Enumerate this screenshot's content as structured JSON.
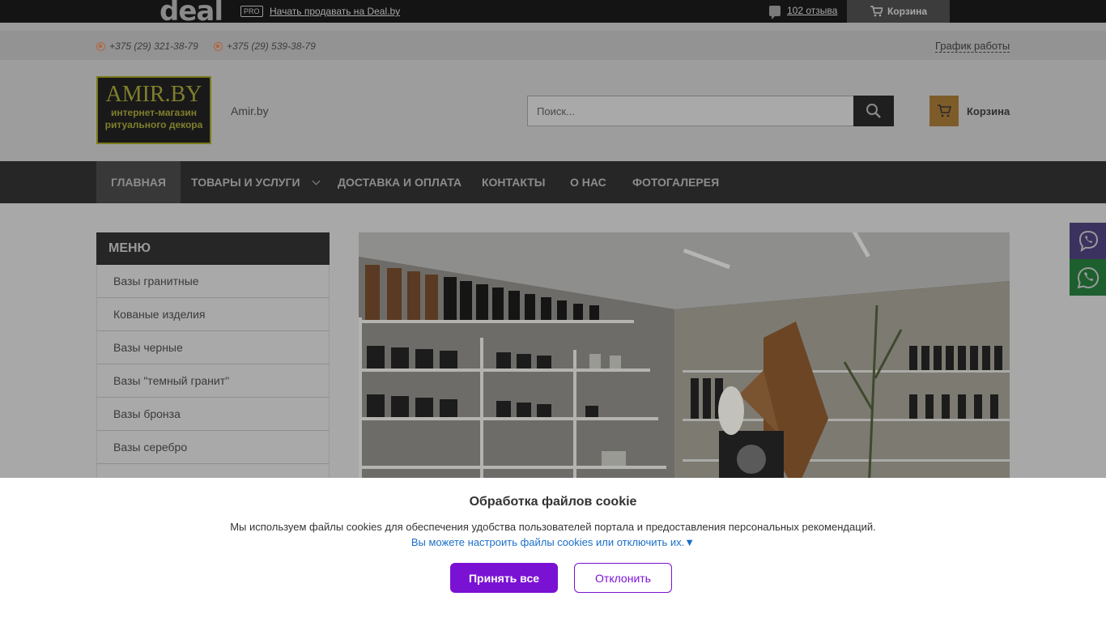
{
  "dealbar": {
    "logo_text": "deal",
    "pro_badge": "PRO",
    "sell_link": "Начать продавать на Deal.by",
    "reviews_link": "102 отзыва",
    "cart_label": "Корзина"
  },
  "contacts": {
    "phone_1": "+375 (29) 321-38-79",
    "phone_2": "+375 (29) 539-38-79",
    "schedule_link": "График работы"
  },
  "header": {
    "logo_title": "AMIR.BY",
    "logo_sub_1": "интернет-магазин",
    "logo_sub_2": "ритуального декора",
    "site_name": "Amir.by",
    "search_placeholder": "Поиск...",
    "cart_label": "Корзина"
  },
  "nav": {
    "items": [
      {
        "label": "ГЛАВНАЯ"
      },
      {
        "label": "ТОВАРЫ И УСЛУГИ"
      },
      {
        "label": "ДОСТАВКА И ОПЛАТА"
      },
      {
        "label": "КОНТАКТЫ"
      },
      {
        "label": "О НАС"
      },
      {
        "label": "ФОТОГАЛЕРЕЯ"
      }
    ]
  },
  "sidebar": {
    "title": "МЕНЮ",
    "items": [
      {
        "label": "Вазы гранитные"
      },
      {
        "label": "Кованые изделия"
      },
      {
        "label": "Вазы черные"
      },
      {
        "label": "Вазы \"темный гранит\""
      },
      {
        "label": "Вазы бронза"
      },
      {
        "label": "Вазы серебро"
      }
    ]
  },
  "messengers": {
    "viber": "viber-icon",
    "whatsapp": "whatsapp-icon"
  },
  "cookie": {
    "title": "Обработка файлов cookie",
    "text": "Мы используем файлы cookies для обеспечения удобства пользователей портала и предоставления персональных рекомендаций.",
    "settings_link": "Вы можете настроить файлы cookies или отключить их.▼",
    "accept_label": "Принять все",
    "decline_label": "Отклонить"
  },
  "colors": {
    "accent_purple": "#7a12d4",
    "link_blue": "#1a6fc9",
    "cart_orange": "#f0a233",
    "viber": "#7360f2",
    "whatsapp": "#25d366"
  }
}
